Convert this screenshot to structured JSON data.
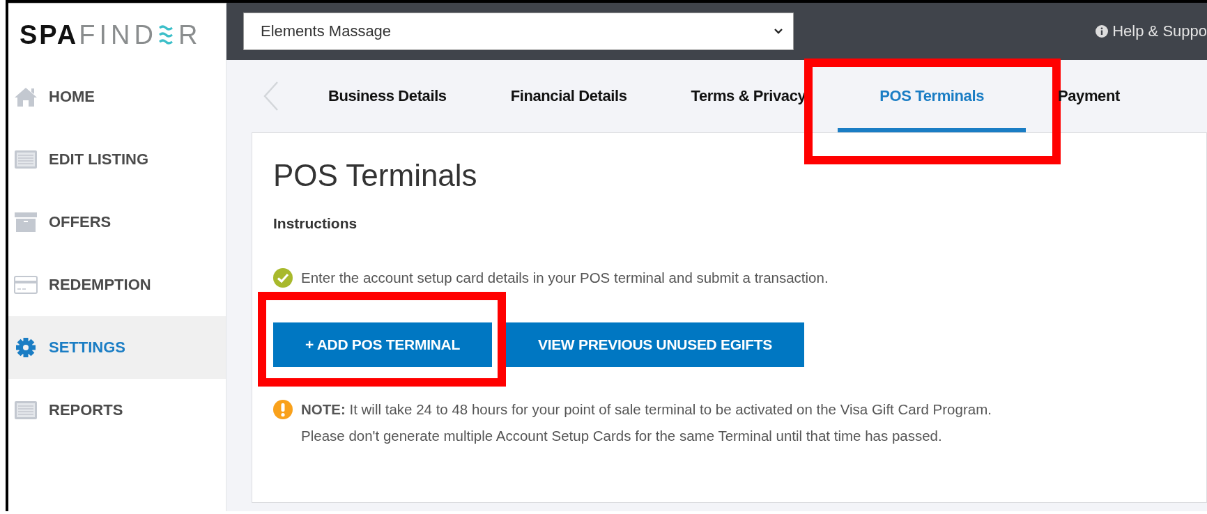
{
  "logo": {
    "bold": "SPA",
    "light": "FIND",
    "end": "R"
  },
  "sidebar": {
    "items": [
      {
        "label": "HOME",
        "kind": "home",
        "selected": false
      },
      {
        "label": "EDIT LISTING",
        "kind": "list",
        "selected": false
      },
      {
        "label": "OFFERS",
        "kind": "box",
        "selected": false
      },
      {
        "label": "REDEMPTION",
        "kind": "card",
        "selected": false
      },
      {
        "label": "SETTINGS",
        "kind": "gear",
        "selected": true
      },
      {
        "label": "REPORTS",
        "kind": "list",
        "selected": false
      }
    ]
  },
  "topbar": {
    "business_select": {
      "value": "Elements Massage"
    },
    "help_link": "Help & Suppo"
  },
  "tabs": [
    {
      "label": "Business Details",
      "selected": false,
      "highlighted": false
    },
    {
      "label": "Financial Details",
      "selected": false,
      "highlighted": false
    },
    {
      "label": "Terms & Privacy",
      "selected": false,
      "highlighted": false
    },
    {
      "label": "POS Terminals",
      "selected": true,
      "highlighted": true
    },
    {
      "label": "Payment",
      "selected": false,
      "highlighted": false
    }
  ],
  "card": {
    "title": "POS Terminals",
    "subtitle": "Instructions",
    "instruction": "Enter the account setup card details in your POS terminal and submit a transaction.",
    "buttons": [
      {
        "label": "+ ADD POS TERMINAL",
        "highlighted": true
      },
      {
        "label": "VIEW PREVIOUS UNUSED EGIFTS",
        "highlighted": false
      }
    ],
    "note": [
      "**NOTE:** It will take 24 to 48 hours for your point of sale terminal to be activated on the Visa Gift Card Program.",
      "Please don't generate multiple Account Setup Cards for the same Terminal until that time has passed."
    ]
  }
}
